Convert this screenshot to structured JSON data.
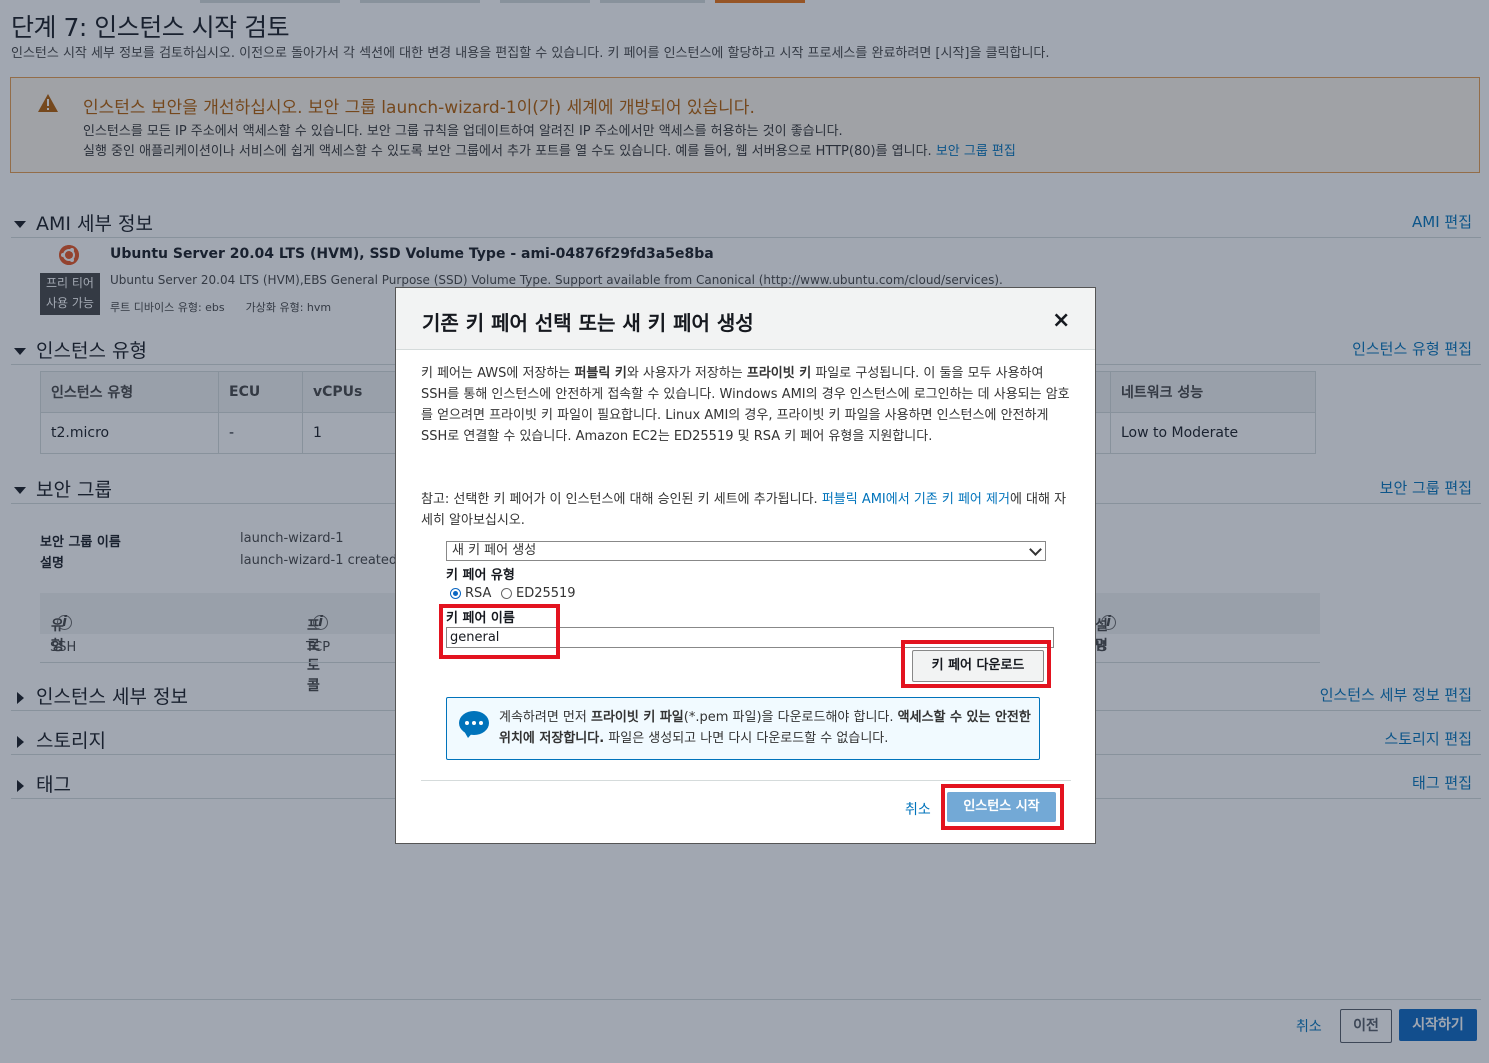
{
  "page": {
    "title": "단계 7: 인스턴스 시작 검토",
    "description": "인스턴스 시작 세부 정보를 검토하십시오. 이전으로 돌아가서 각 섹션에 대한 변경 내용을 편집할 수 있습니다. 키 페어를 인스턴스에 할당하고 시작 프로세스를 완료하려면 [시작]을 클릭합니다."
  },
  "warning": {
    "title": "인스턴스 보안을 개선하십시오. 보안 그룹 launch-wizard-1이(가) 세계에 개방되어 있습니다.",
    "line1": "인스턴스를 모든 IP 주소에서 액세스할 수 있습니다. 보안 그룹 규칙을 업데이트하여 알려진 IP 주소에서만 액세스를 허용하는 것이 좋습니다.",
    "line2": "실행 중인 애플리케이션이나 서비스에 쉽게 액세스할 수 있도록 보안 그룹에서 추가 포트를 열 수도 있습니다. 예를 들어, 웹 서버용으로 HTTP(80)를 엽니다.",
    "link": "보안 그룹 편집",
    "color": "#b35c00"
  },
  "ami": {
    "header": "AMI 세부 정보",
    "edit": "AMI 편집",
    "name": "Ubuntu Server 20.04 LTS (HVM), SSD Volume Type - ami-04876f29fd3a5e8ba",
    "desc": "Ubuntu Server 20.04 LTS (HVM),EBS General Purpose (SSD) Volume Type. Support available from Canonical (http://www.ubuntu.com/cloud/services).",
    "free_tier_1": "프리 티어",
    "free_tier_2": "사용 가능",
    "root_device": "루트 디바이스 유형: ebs",
    "virtualization": "가상화 유형: hvm"
  },
  "instance_type": {
    "header": "인스턴스 유형",
    "edit": "인스턴스 유형 편집",
    "columns": [
      "인스턴스 유형",
      "ECU",
      "vCPUs",
      "네트워크 성능"
    ],
    "row": [
      "t2.micro",
      "-",
      "1",
      "Low to Moderate"
    ]
  },
  "security_group": {
    "header": "보안 그룹",
    "edit": "보안 그룹 편집",
    "name_label": "보안 그룹 이름",
    "name_value": "launch-wizard-1",
    "desc_label": "설명",
    "desc_value": "launch-wizard-1 created 2",
    "rule_columns": [
      "유형",
      "프로토콜",
      "설명"
    ],
    "rule_row": [
      "SSH",
      "TCP",
      "H"
    ]
  },
  "collapsed_sections": {
    "details": "인스턴스 세부 정보",
    "details_edit": "인스턴스 세부 정보 편집",
    "storage": "스토리지",
    "storage_edit": "스토리지 편집",
    "tags": "태그",
    "tags_edit": "태그 편집"
  },
  "footer": {
    "cancel": "취소",
    "previous": "이전",
    "launch": "시작하기"
  },
  "modal": {
    "title": "기존 키 페어 선택 또는 새 키 페어 생성",
    "close": "×",
    "intro_1": "키 페어는 AWS에 저장하는 ",
    "intro_public_key": "퍼블릭 키",
    "intro_2": "와 사용자가 저장하는 ",
    "intro_private_key": "프라이빗 키",
    "intro_3": " 파일로 구성됩니다. 이 둘을 모두 사용하여 SSH를 통해 인스턴스에 안전하게 접속할 수 있습니다. Windows AMI의 경우 인스턴스에 로그인하는 데 사용되는 암호를 얻으려면 프라이빗 키 파일이 필요합니다. Linux AMI의 경우, 프라이빗 키 파일을 사용하면 인스턴스에 안전하게 SSH로 연결할 수 있습니다. Amazon EC2는 ED25519 및 RSA 키 페어 유형을 지원합니다.",
    "note_1": "참고: 선택한 키 페어가 이 인스턴스에 대해 승인된 키 세트에 추가됩니다. ",
    "note_link": "퍼블릭 AMI에서 기존 키 페어 제거",
    "note_2": "에 대해 자세히 알아보십시오.",
    "select_value": "새 키 페어 생성",
    "key_type_label": "키 페어 유형",
    "radio_rsa": "RSA",
    "radio_ed": "ED25519",
    "key_name_label": "키 페어 이름",
    "key_name_value": "general",
    "download_button": "키 페어 다운로드",
    "info_1": "계속하려면 먼저 ",
    "info_bold_1": "프라이빗 키 파일",
    "info_2": "(*.pem 파일)을 다운로드해야 합니다. ",
    "info_bold_2": "액세스할 수 있는 안전한 위치에 저장합니다.",
    "info_3": " 파일은 생성되고 나면 다시 다운로드할 수 없습니다.",
    "cancel": "취소",
    "launch": "인스턴스 시작"
  }
}
